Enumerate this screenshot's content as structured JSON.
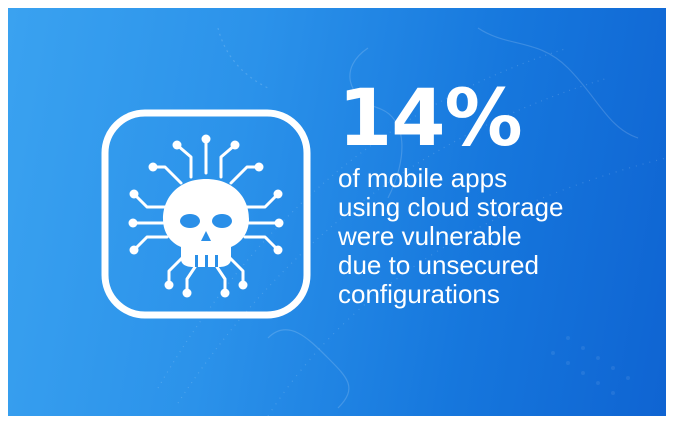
{
  "icon": "skull-circuit-icon",
  "colors": {
    "background_start": "#3aa2f0",
    "background_end": "#0f64d2",
    "foreground": "#ffffff"
  },
  "stat": {
    "value": "14%",
    "lines": [
      "of mobile apps",
      "using cloud storage",
      "were vulnerable",
      "due to unsecured",
      "configurations"
    ]
  }
}
